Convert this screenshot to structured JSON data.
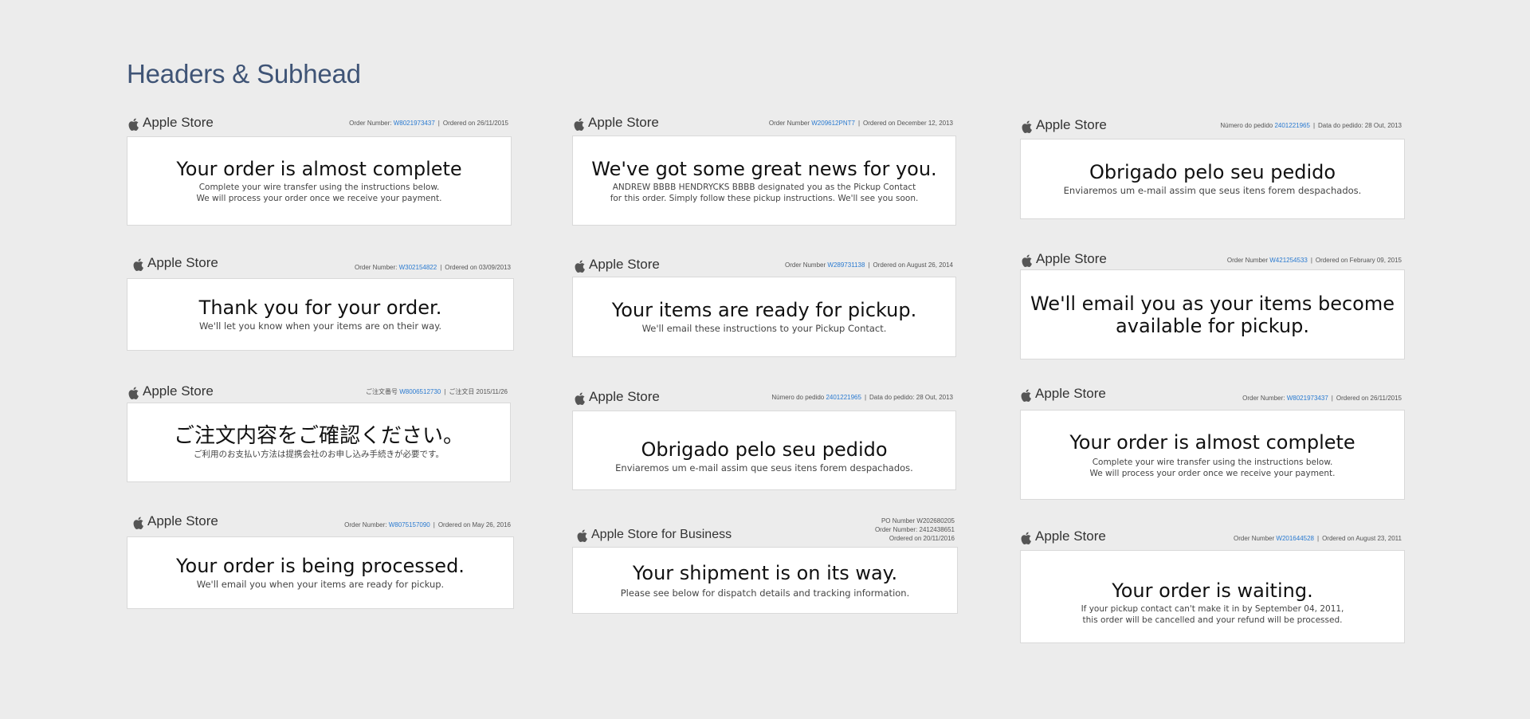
{
  "page": {
    "title": "Headers & Subhead"
  },
  "cards": [
    {
      "brand": "Apple Store",
      "meta_label": "Order Number:",
      "order_number": "W8021973437",
      "meta_date": "Ordered on 26/11/2015",
      "headline": "Your order is almost complete",
      "sub": [
        "Complete your wire transfer using the instructions below.",
        "We will process your order once we receive your payment."
      ]
    },
    {
      "brand": "Apple Store",
      "meta_label": "Order Number:",
      "order_number": "W302154822",
      "meta_date": "Ordered on 03/09/2013",
      "headline": "Thank you for your order.",
      "sub": [
        "We'll let you know when your items are on their way."
      ]
    },
    {
      "brand": "Apple Store",
      "meta_label": "ご注文番号",
      "order_number": "W8006512730",
      "meta_date": "ご注文日 2015/11/26",
      "headline": "ご注文内容をご確認ください。",
      "sub": [
        "ご利用のお支払い方法は提携会社のお申し込み手続きが必要です。"
      ]
    },
    {
      "brand": "Apple Store",
      "meta_label": "Order Number:",
      "order_number": "W8075157090",
      "meta_date": "Ordered on May 26, 2016",
      "headline": "Your order is being processed.",
      "sub": [
        "We'll email you when your items are ready for pickup."
      ]
    },
    {
      "brand": "Apple Store",
      "meta_label": "Order Number",
      "order_number": "W209612PNT7",
      "meta_date": "Ordered on December 12, 2013",
      "headline": "We've got some great news for you.",
      "sub": [
        "ANDREW BBBB HENDRYCKS BBBB designated you as the Pickup Contact",
        "for this order. Simply follow these pickup instructions. We'll see you soon."
      ]
    },
    {
      "brand": "Apple Store",
      "meta_label": "Order Number",
      "order_number": "W289731138",
      "meta_date": "Ordered on August 26, 2014",
      "headline": "Your items are ready for pickup.",
      "sub": [
        "We'll email these instructions to your Pickup Contact."
      ]
    },
    {
      "brand": "Apple Store",
      "meta_label": "Número do pedido",
      "order_number": "2401221965",
      "meta_date": "Data do pedido: 28 Out, 2013",
      "headline": "Obrigado pelo seu pedido",
      "sub": [
        "Enviaremos um e-mail assim que seus itens forem despachados."
      ]
    },
    {
      "brand": "Apple Store for Business",
      "meta_lines": [
        "PO Number W202680205",
        "Order Number: 2412438651",
        "Ordered on 20/11/2016"
      ],
      "headline": "Your shipment is on its way.",
      "sub": [
        "Please see below for dispatch details and tracking information."
      ]
    },
    {
      "brand": "Apple Store",
      "meta_label": "Número do pedido",
      "order_number": "2401221965",
      "meta_date": "Data do pedido: 28 Out, 2013",
      "headline": "Obrigado pelo seu pedido",
      "sub": [
        "Enviaremos um e-mail assim que seus itens forem despachados."
      ]
    },
    {
      "brand": "Apple Store",
      "meta_label": "Order Number",
      "order_number": "W421254533",
      "meta_date": "Ordered on February 09, 2015",
      "headline": "We'll email you as your items become",
      "headline2": "available for pickup.",
      "sub": []
    },
    {
      "brand": "Apple Store",
      "meta_label": "Order Number:",
      "order_number": "W8021973437",
      "meta_date": "Ordered on 26/11/2015",
      "headline": "Your order is almost complete",
      "sub": [
        "Complete your wire transfer using the instructions below.",
        "We will process your order once we receive your payment."
      ]
    },
    {
      "brand": "Apple Store",
      "meta_label": "Order Number",
      "order_number": "W201644528",
      "meta_date": "Ordered on August 23, 2011",
      "headline": "Your order is waiting.",
      "sub": [
        "If your pickup contact can't make it in by September 04, 2011,",
        "this order will be cancelled and your refund will be processed."
      ]
    }
  ]
}
